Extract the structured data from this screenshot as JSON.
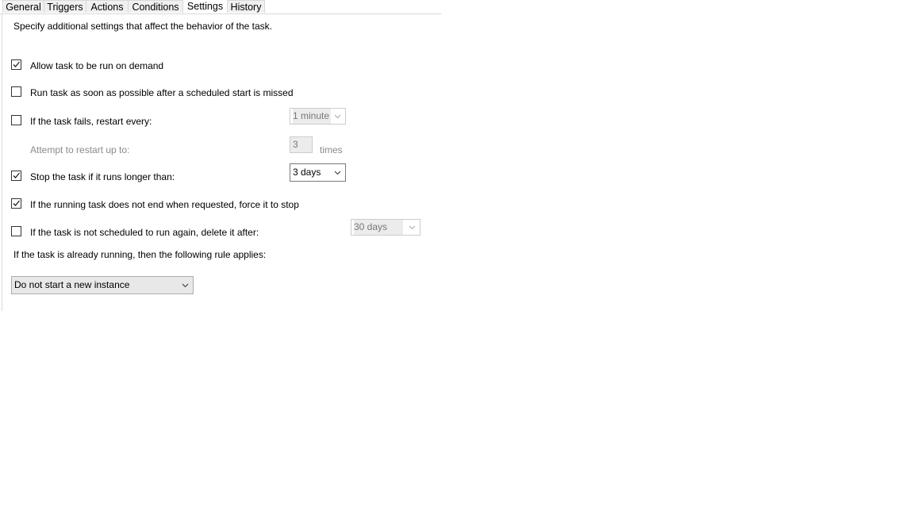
{
  "tabs": [
    {
      "label": "General"
    },
    {
      "label": "Triggers"
    },
    {
      "label": "Actions"
    },
    {
      "label": "Conditions"
    },
    {
      "label": "Settings",
      "selected": true
    },
    {
      "label": "History"
    }
  ],
  "settings": {
    "description": "Specify additional settings that affect the behavior of the task.",
    "allow_on_demand": {
      "label": "Allow task to be run on demand",
      "checked": true
    },
    "run_asap": {
      "label": "Run task as soon as possible after a scheduled start is missed",
      "checked": false
    },
    "restart": {
      "label": "If the task fails, restart every:",
      "checked": false,
      "value": "1 minute"
    },
    "attempt": {
      "label": "Attempt to restart up to:",
      "value": "3",
      "suffix": "times"
    },
    "stop_long": {
      "label": "Stop the task if it runs longer than:",
      "checked": true,
      "value": "3 days"
    },
    "force_stop": {
      "label": "If the running task does not end when requested, force it to stop",
      "checked": true
    },
    "delete_after": {
      "label": "If the task is not scheduled to run again, delete it after:",
      "checked": false,
      "value": "30 days"
    },
    "rule_label": "If the task is already running, then the following rule applies:",
    "rule_value": "Do not start a new instance"
  }
}
